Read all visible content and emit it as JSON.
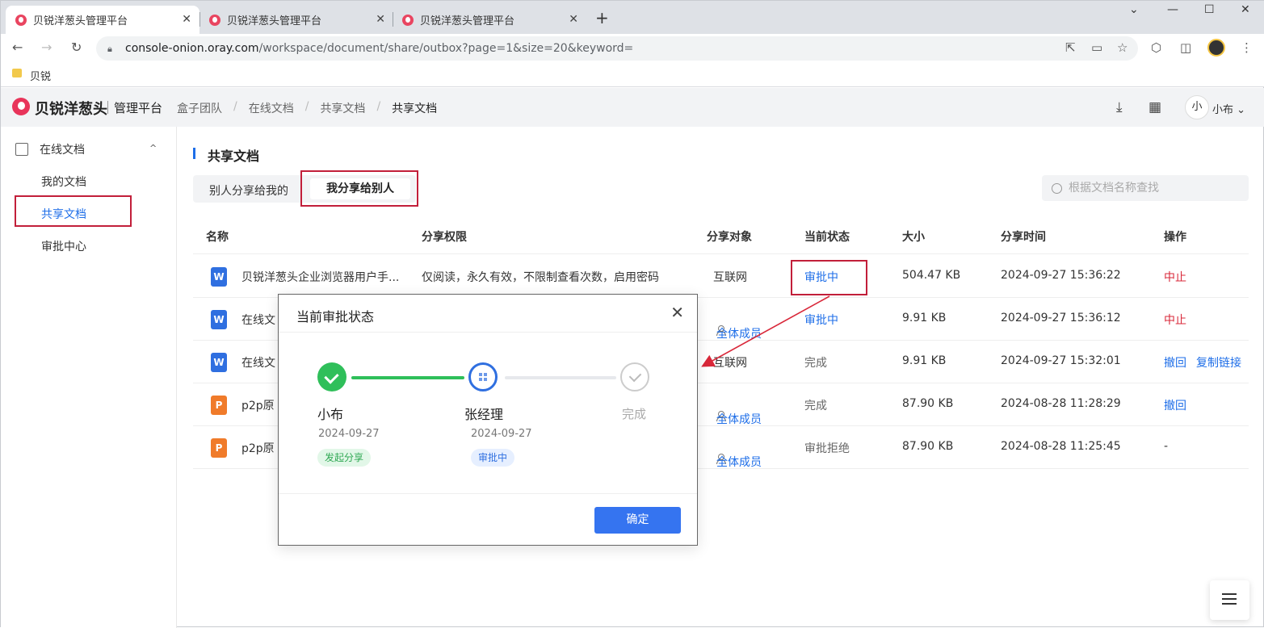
{
  "browser": {
    "tabs": [
      {
        "title": "贝锐洋葱头管理平台",
        "active": true
      },
      {
        "title": "贝锐洋葱头管理平台",
        "active": false
      },
      {
        "title": "贝锐洋葱头管理平台",
        "active": false
      }
    ],
    "url_host": "console-onion.oray.com",
    "url_path": "/workspace/document/share/outbox?page=1&size=20&keyword=",
    "bookmark": "贝锐"
  },
  "app": {
    "logo_text": "贝锐洋葱头",
    "logo_sub": "管理平台",
    "breadcrumb": [
      "盒子团队",
      "在线文档",
      "共享文档",
      "共享文档"
    ],
    "user_initial": "小",
    "user_name": "小布"
  },
  "sidebar": {
    "group": "在线文档",
    "items": [
      "我的文档",
      "共享文档",
      "审批中心"
    ],
    "active": "共享文档"
  },
  "main": {
    "title": "共享文档",
    "segment": [
      "别人分享给我的",
      "我分享给别人"
    ],
    "segment_selected": "我分享给别人",
    "search_placeholder": "根据文档名称查找",
    "columns": [
      "名称",
      "分享权限",
      "分享对象",
      "当前状态",
      "大小",
      "分享时间",
      "操作"
    ],
    "rows": [
      {
        "icon": "W",
        "name": "贝锐洋葱头企业浏览器用户手...",
        "perm": "仅阅读，永久有效，不限制查看次数，启用密码",
        "target": "互联网",
        "status": "审批中",
        "size": "504.47 KB",
        "time": "2024-09-27 15:36:22",
        "actions": [
          "中止"
        ]
      },
      {
        "icon": "W",
        "name": "在线文",
        "perm": "",
        "target": "全体成员",
        "status": "审批中",
        "size": "9.91 KB",
        "time": "2024-09-27 15:36:12",
        "actions": [
          "中止"
        ]
      },
      {
        "icon": "W",
        "name": "在线文",
        "perm": "",
        "target": "互联网",
        "status": "完成",
        "size": "9.91 KB",
        "time": "2024-09-27 15:32:01",
        "actions": [
          "撤回",
          "复制链接"
        ]
      },
      {
        "icon": "P",
        "name": "p2p原",
        "perm": "",
        "target": "全体成员",
        "status": "完成",
        "size": "87.90 KB",
        "time": "2024-08-28 11:28:29",
        "actions": [
          "撤回"
        ]
      },
      {
        "icon": "P",
        "name": "p2p原",
        "perm": "",
        "target": "全体成员",
        "status": "审批拒绝",
        "size": "87.90 KB",
        "time": "2024-08-28 11:25:45",
        "actions": [
          "-"
        ]
      }
    ]
  },
  "modal": {
    "title": "当前审批状态",
    "steps": [
      {
        "name": "小布",
        "date": "2024-09-27",
        "tag": "发起分享",
        "state": "done"
      },
      {
        "name": "张经理",
        "date": "2024-09-27",
        "tag": "审批中",
        "state": "current"
      },
      {
        "name": "完成",
        "date": "",
        "tag": "",
        "state": "pending"
      }
    ],
    "ok_label": "确定"
  },
  "colors": {
    "accent": "#1e6ee8",
    "danger": "#d9283a",
    "success": "#2fbf5a",
    "annotation": "#c21f3a"
  }
}
